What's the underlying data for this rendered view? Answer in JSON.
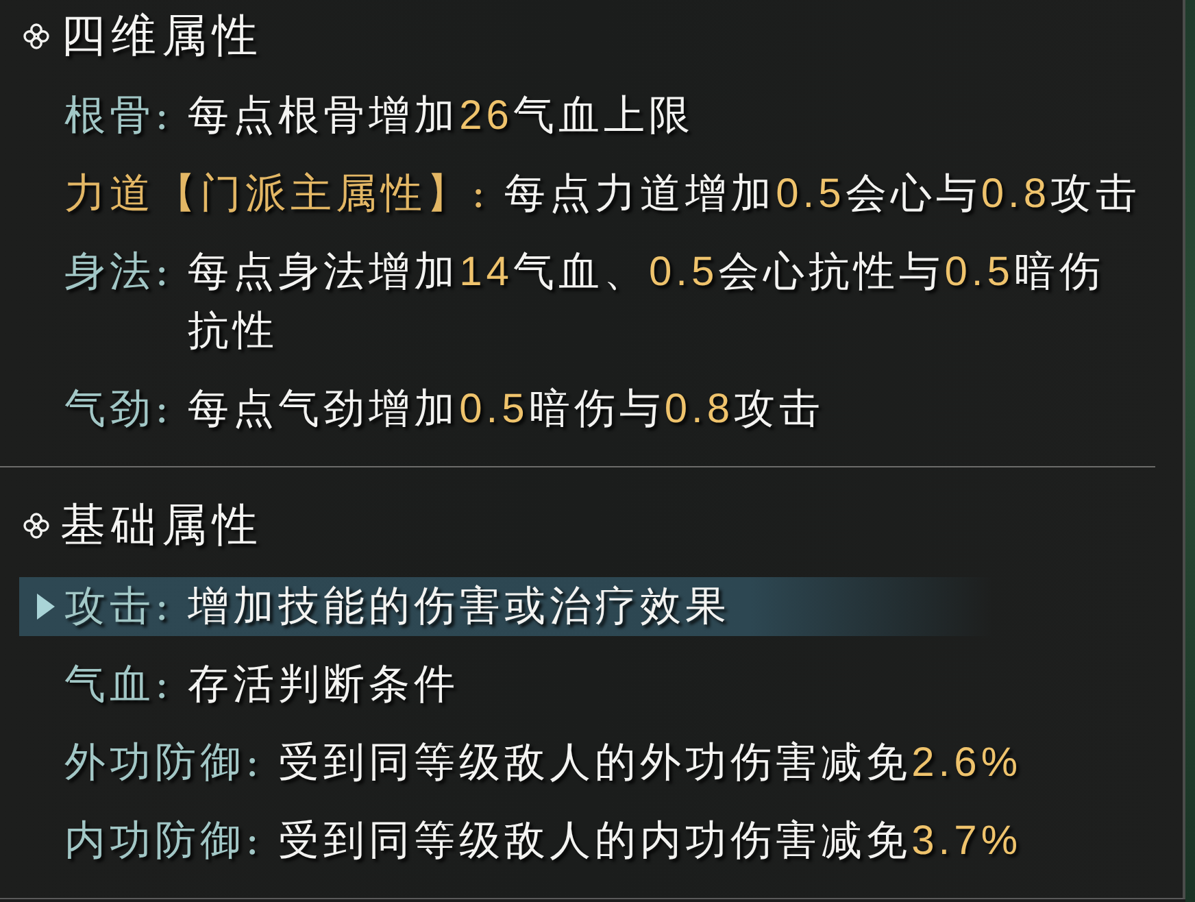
{
  "sections": [
    {
      "title": "四维属性",
      "rows": [
        {
          "label": "根骨:",
          "main_attribute": false,
          "description": [
            {
              "text": "每点根骨增加",
              "highlight": false
            },
            {
              "text": "26",
              "highlight": true
            },
            {
              "text": "气血上限",
              "highlight": false
            }
          ]
        },
        {
          "label": "力道【门派主属性】:",
          "main_attribute": true,
          "description": [
            {
              "text": "每点力道增加",
              "highlight": false
            },
            {
              "text": "0.5",
              "highlight": true
            },
            {
              "text": "会心与",
              "highlight": false
            },
            {
              "text": "0.8",
              "highlight": true
            },
            {
              "text": "攻击",
              "highlight": false
            }
          ]
        },
        {
          "label": "身法:",
          "main_attribute": false,
          "description": [
            {
              "text": "每点身法增加",
              "highlight": false
            },
            {
              "text": "14",
              "highlight": true
            },
            {
              "text": "气血、",
              "highlight": false
            },
            {
              "text": "0.5",
              "highlight": true
            },
            {
              "text": "会心抗性与",
              "highlight": false
            },
            {
              "text": "0.5",
              "highlight": true
            },
            {
              "text": "暗伤抗性",
              "highlight": false
            }
          ]
        },
        {
          "label": "气劲:",
          "main_attribute": false,
          "description": [
            {
              "text": "每点气劲增加",
              "highlight": false
            },
            {
              "text": "0.5",
              "highlight": true
            },
            {
              "text": "暗伤与",
              "highlight": false
            },
            {
              "text": "0.8",
              "highlight": true
            },
            {
              "text": "攻击",
              "highlight": false
            }
          ]
        }
      ]
    },
    {
      "title": "基础属性",
      "rows": [
        {
          "label": "攻击:",
          "selected": true,
          "description": [
            {
              "text": "增加技能的伤害或治疗效果",
              "highlight": false
            }
          ]
        },
        {
          "label": "气血:",
          "selected": false,
          "description": [
            {
              "text": "存活判断条件",
              "highlight": false
            }
          ]
        },
        {
          "label": "外功防御:",
          "selected": false,
          "description": [
            {
              "text": "受到同等级敌人的外功伤害减免",
              "highlight": false
            },
            {
              "text": "2.6%",
              "highlight": true
            }
          ]
        },
        {
          "label": "内功防御:",
          "selected": false,
          "description": [
            {
              "text": "受到同等级敌人的内功伤害减免",
              "highlight": false
            },
            {
              "text": "3.7%",
              "highlight": true
            }
          ]
        }
      ]
    }
  ]
}
